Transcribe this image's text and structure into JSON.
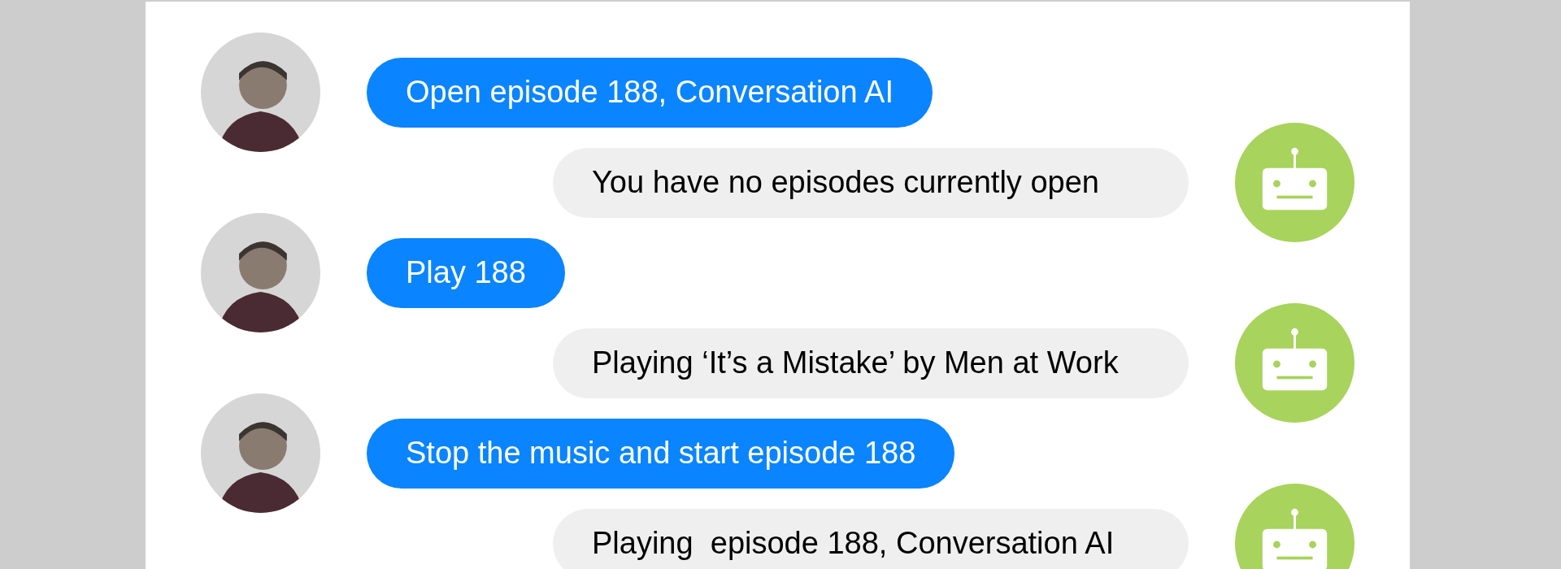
{
  "messages": [
    {
      "kind": "user",
      "text": "Open episode 188, Conversation AI"
    },
    {
      "kind": "bot",
      "text": "You have no episodes currently open"
    },
    {
      "kind": "user",
      "text": "Play 188"
    },
    {
      "kind": "bot",
      "text": "Playing ‘It’s a Mistake’ by Men at Work"
    },
    {
      "kind": "user",
      "text": "Stop the music and start episode 188"
    },
    {
      "kind": "bot",
      "text": "Playing  episode 188, Conversation AI"
    }
  ]
}
